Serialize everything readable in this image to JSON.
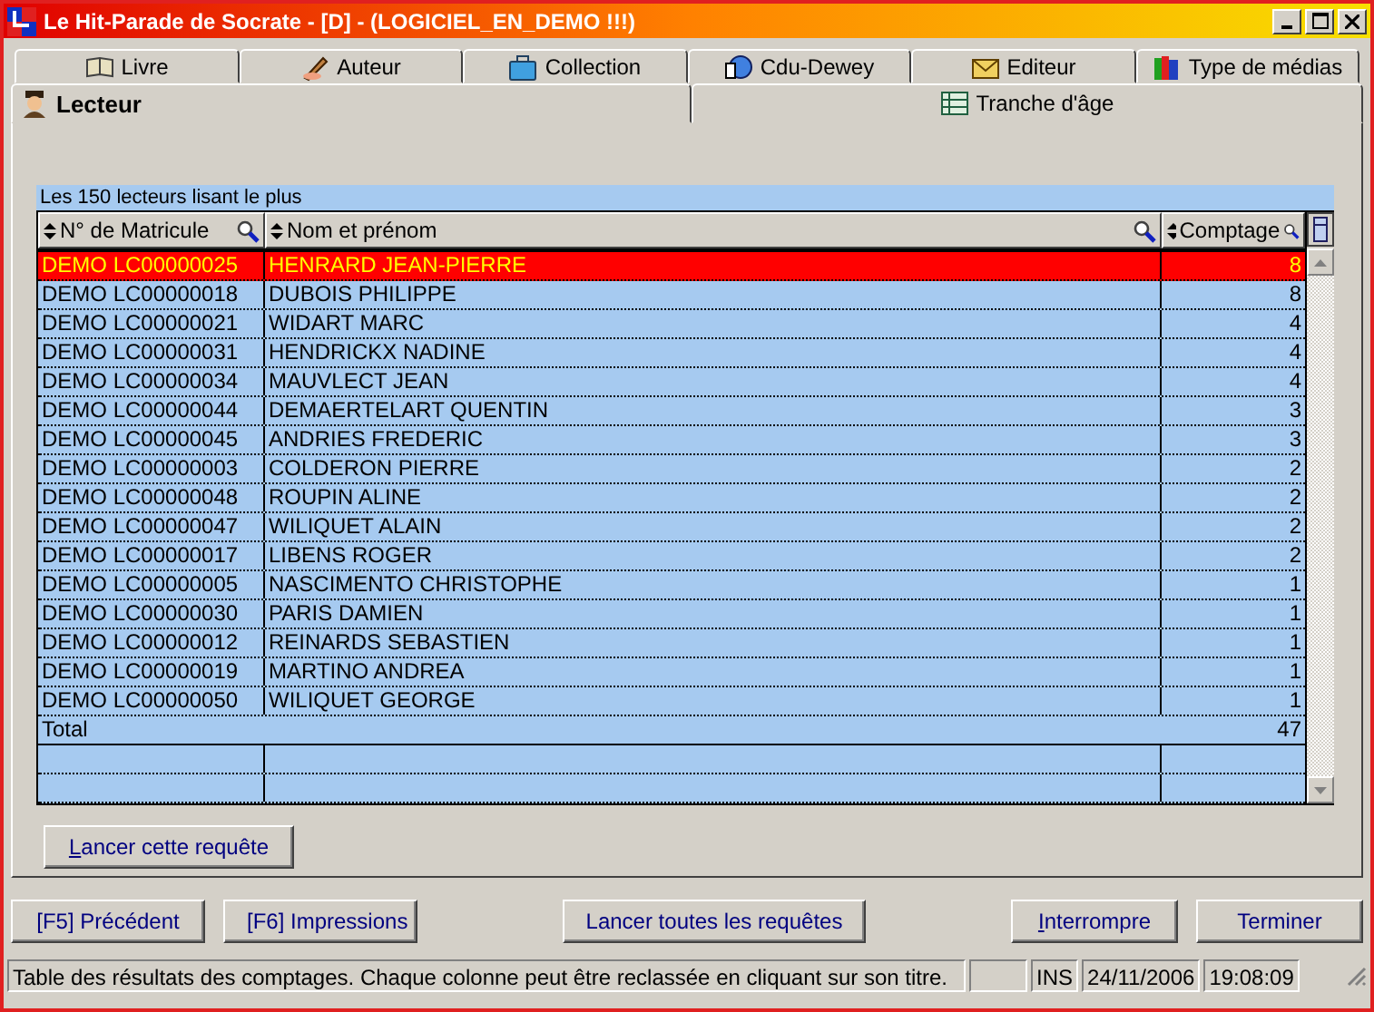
{
  "window": {
    "title": "Le Hit-Parade de Socrate - [D] - (LOGICIEL_EN_DEMO !!!)"
  },
  "tabs_row_1": [
    {
      "label": "Livre",
      "selected": false
    },
    {
      "label": "Auteur",
      "selected": false
    },
    {
      "label": "Collection",
      "selected": false
    },
    {
      "label": "Cdu-Dewey",
      "selected": false
    },
    {
      "label": "Editeur",
      "selected": false
    },
    {
      "label": "Type de médias",
      "selected": false
    }
  ],
  "tabs_row_2": [
    {
      "label": "Lecteur",
      "selected": true
    },
    {
      "label": "Tranche d'âge",
      "selected": false
    }
  ],
  "table": {
    "caption": "Les 150 lecteurs lisant le plus",
    "columns": [
      "N° de Matricule",
      "Nom et prénom",
      "Comptage"
    ],
    "rows": [
      {
        "id": "DEMO LC00000025",
        "name": "HENRARD JEAN-PIERRE",
        "count": "8",
        "selected": true
      },
      {
        "id": "DEMO LC00000018",
        "name": "DUBOIS PHILIPPE",
        "count": "8",
        "selected": false
      },
      {
        "id": "DEMO LC00000021",
        "name": "WIDART MARC",
        "count": "4",
        "selected": false
      },
      {
        "id": "DEMO LC00000031",
        "name": "HENDRICKX NADINE",
        "count": "4",
        "selected": false
      },
      {
        "id": "DEMO LC00000034",
        "name": "MAUVLECT JEAN",
        "count": "4",
        "selected": false
      },
      {
        "id": "DEMO LC00000044",
        "name": "DEMAERTELART QUENTIN",
        "count": "3",
        "selected": false
      },
      {
        "id": "DEMO LC00000045",
        "name": "ANDRIES FREDERIC",
        "count": "3",
        "selected": false
      },
      {
        "id": "DEMO LC00000003",
        "name": "COLDERON PIERRE",
        "count": "2",
        "selected": false
      },
      {
        "id": "DEMO LC00000048",
        "name": "ROUPIN ALINE",
        "count": "2",
        "selected": false
      },
      {
        "id": "DEMO LC00000047",
        "name": "WILIQUET ALAIN",
        "count": "2",
        "selected": false
      },
      {
        "id": "DEMO LC00000017",
        "name": "LIBENS ROGER",
        "count": "2",
        "selected": false
      },
      {
        "id": "DEMO LC00000005",
        "name": "NASCIMENTO CHRISTOPHE",
        "count": "1",
        "selected": false
      },
      {
        "id": "DEMO LC00000030",
        "name": "PARIS DAMIEN",
        "count": "1",
        "selected": false
      },
      {
        "id": "DEMO LC00000012",
        "name": "REINARDS SEBASTIEN",
        "count": "1",
        "selected": false
      },
      {
        "id": "DEMO LC00000019",
        "name": "MARTINO ANDREA",
        "count": "1",
        "selected": false
      },
      {
        "id": "DEMO LC00000050",
        "name": "WILIQUET GEORGE",
        "count": "1",
        "selected": false
      }
    ],
    "total_label": "Total",
    "total_value": "47"
  },
  "query_button": {
    "label": "Lancer cette requête",
    "mnemonic": true
  },
  "bottom_buttons": [
    {
      "label": "[F5] Précédent",
      "mnemonic": false,
      "kind": "left"
    },
    {
      "label": "[F6] Impressions",
      "mnemonic": false,
      "kind": "left"
    },
    {
      "label": "Lancer toutes les requêtes",
      "mnemonic": false,
      "kind": "center"
    },
    {
      "label": "Interrompre",
      "mnemonic": true,
      "kind": "right"
    },
    {
      "label": "Terminer",
      "mnemonic": false,
      "kind": "right"
    }
  ],
  "status_bar": {
    "message": "Table des résultats des comptages. Chaque colonne peut être reclassée en cliquant sur son titre.",
    "mode": "INS",
    "date": "24/11/2006",
    "time": "19:08:09"
  }
}
